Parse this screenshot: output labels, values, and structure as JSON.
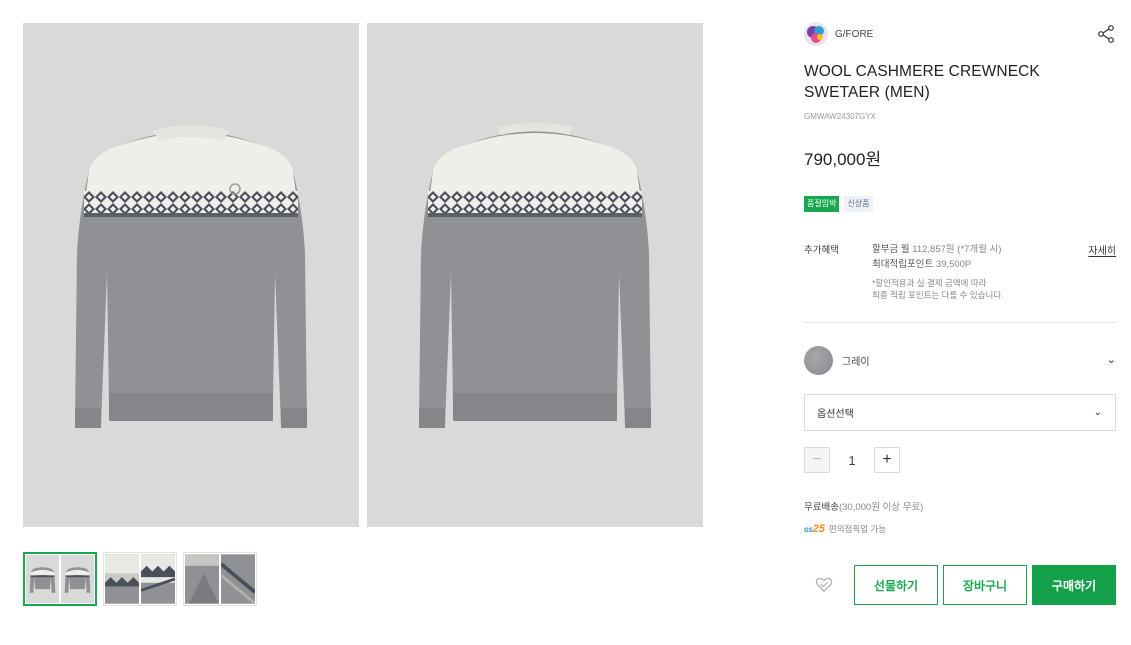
{
  "brand": {
    "name": "G/FORE",
    "logo_icon": "brand-logo-icon"
  },
  "product": {
    "title": "WOOL CASHMERE CREWNECK SWETAER (MEN)",
    "code": "GMWAW24307GYX",
    "price": "790,000원",
    "tags": [
      "품절임박",
      "신상품"
    ]
  },
  "benefit": {
    "label": "추가혜택",
    "installment_prefix": "할부금 월",
    "installment_value": "112,857원",
    "installment_suffix": "(*7개월 시)",
    "points_label": "최대적립포인트",
    "points_value": "39,500P",
    "note_line1": "*할인적용과 실 결제 금액에 따라",
    "note_line2": "최종 적립 포인트는 다를 수 있습니다.",
    "detail_link": "자세히"
  },
  "color": {
    "name": "그레이",
    "swatch": "#939598"
  },
  "option": {
    "placeholder": "옵션선택"
  },
  "quantity": {
    "value": "1",
    "minus": "−",
    "plus": "+"
  },
  "shipping": {
    "label": "무료배송",
    "condition": "(30,000원 이상 무료)",
    "gs_logo_prefix": "GS",
    "gs_logo_number": "25",
    "gs_text": "편의점픽업 가능"
  },
  "actions": {
    "gift": "선물하기",
    "cart": "장바구니",
    "buy": "구매하기"
  },
  "colors": {
    "accent": "#19a84f",
    "photo_bg": "#d9d9d9"
  }
}
